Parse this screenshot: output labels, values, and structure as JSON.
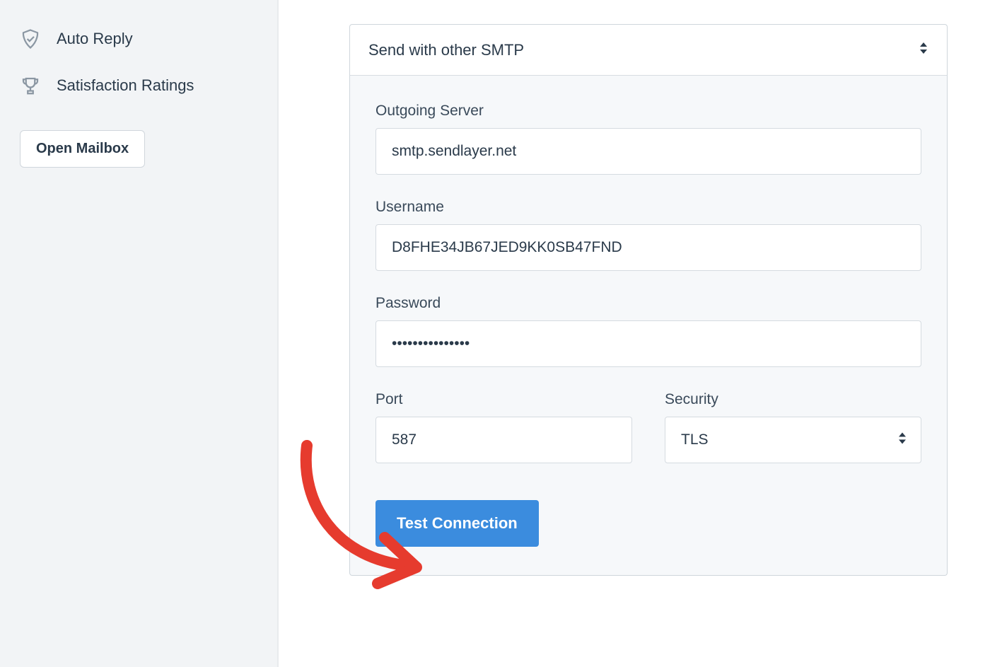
{
  "sidebar": {
    "items": [
      {
        "label": "Auto Reply"
      },
      {
        "label": "Satisfaction Ratings"
      }
    ],
    "open_mailbox_label": "Open Mailbox"
  },
  "main": {
    "smtp_selector": "Send with other SMTP",
    "fields": {
      "outgoing_server_label": "Outgoing Server",
      "outgoing_server_value": "smtp.sendlayer.net",
      "username_label": "Username",
      "username_value": "D8FHE34JB67JED9KK0SB47FND",
      "password_label": "Password",
      "password_value": "•••••••••••••••",
      "port_label": "Port",
      "port_value": "587",
      "security_label": "Security",
      "security_value": "TLS"
    },
    "test_connection_label": "Test Connection"
  }
}
